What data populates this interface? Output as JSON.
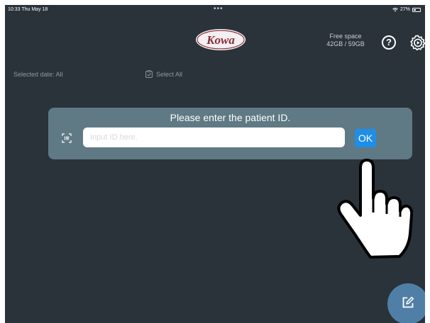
{
  "status_bar": {
    "time_date": "10:33  Thu May 18",
    "dots": "•••",
    "battery_percent": "27%"
  },
  "header": {
    "logo_text": "Kowa",
    "free_space_label": "Free space",
    "free_space_value": "42GB / 59GB",
    "help_icon": "question-circle-icon",
    "settings_icon": "gear-icon"
  },
  "toolbar": {
    "selected_date": "Selected date: All",
    "select_all": "Select All",
    "select_all_icon": "clipboard-check-icon"
  },
  "dialog": {
    "title": "Please enter the patient ID.",
    "scan_icon": "barcode-scan-icon",
    "input_value": "",
    "input_placeholder": "Input ID here.",
    "ok_label": "OK"
  },
  "overlay": {
    "pointer": "pointing-hand-icon"
  },
  "fab": {
    "icon": "edit-icon",
    "color": "#4f7fa6"
  },
  "colors": {
    "background": "#2a333a",
    "dialog": "#5f7a84",
    "accent": "#1e8ee8",
    "logo": "#8a2e3a"
  }
}
